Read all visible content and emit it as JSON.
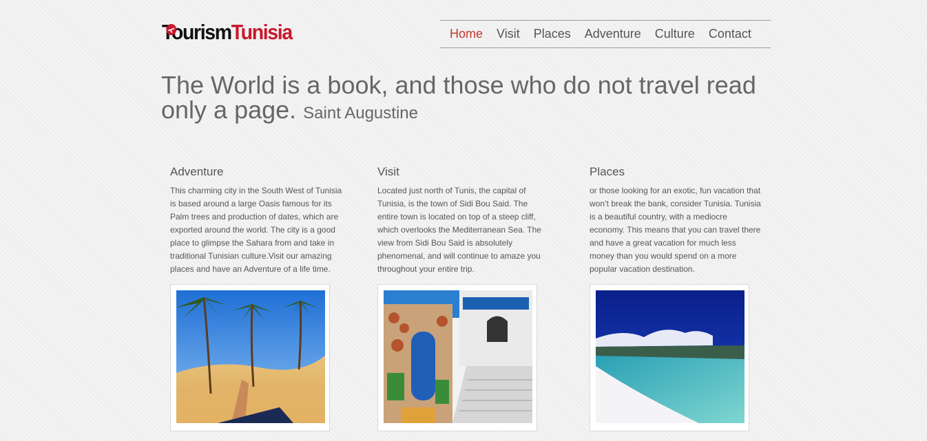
{
  "logo": {
    "part1": "Tourism",
    "part2": "Tunisia"
  },
  "nav": [
    {
      "label": "Home",
      "active": true
    },
    {
      "label": "Visit",
      "active": false
    },
    {
      "label": "Places",
      "active": false
    },
    {
      "label": "Adventure",
      "active": false
    },
    {
      "label": "Culture",
      "active": false
    },
    {
      "label": "Contact",
      "active": false
    }
  ],
  "quote": {
    "text": "The World is a book, and those who do not travel read only a page.",
    "author": "Saint Augustine"
  },
  "columns": [
    {
      "title": "Adventure",
      "body": "This charming city in the South West of Tunisia is based around a large Oasis famous for its Palm trees and production of dates, which are exported around the world. The city is a good place to glimpse the Sahara from and take in traditional Tunisian culture.Visit our amazing places and have an Adventure of a life time."
    },
    {
      "title": "Visit",
      "body": "Located just north of Tunis, the capital of Tunisia, is the town of Sidi Bou Said. The entire town is located on top of a steep cliff, which overlooks the Mediterranean Sea. The view from Sidi Bou Said is absolutely phenomenal, and will continue to amaze you throughout your entire trip."
    },
    {
      "title": "Places",
      "body": "or those looking for an exotic, fun vacation that won’t break the bank, consider Tunisia. Tunisia is a beautiful country, with a mediocre economy. This means that you can travel there and have a great vacation for much less money than you would spend on a more popular vacation destination."
    }
  ],
  "colors": {
    "accent": "#c0392b",
    "logo_red": "#c9182c",
    "text": "#555555"
  }
}
